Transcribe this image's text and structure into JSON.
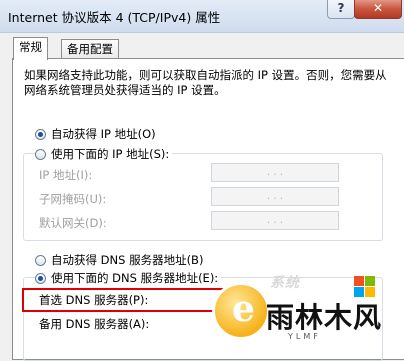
{
  "window": {
    "title": "Internet 协议版本 4 (TCP/IPv4) 属性",
    "help_label": "?",
    "close_label": "✕"
  },
  "tabs": [
    {
      "label": "常规",
      "active": true
    },
    {
      "label": "备用配置",
      "active": false
    }
  ],
  "description": "如果网络支持此功能，则可以获取自动指派的 IP 设置。否则，您需要从网络系统管理员处获得适当的 IP 设置。",
  "ip_section": {
    "auto_label": "自动获得 IP 地址(O)",
    "auto_selected": true,
    "manual_label": "使用下面的 IP 地址(S):",
    "manual_selected": false,
    "fields": [
      {
        "label": "IP 地址(I):",
        "value": ".   .   ."
      },
      {
        "label": "子网掩码(U):",
        "value": ".   .   ."
      },
      {
        "label": "默认网关(D):",
        "value": ".   .   ."
      }
    ]
  },
  "dns_section": {
    "auto_label": "自动获得 DNS 服务器地址(B)",
    "auto_selected": false,
    "manual_label": "使用下面的 DNS 服务器地址(E):",
    "manual_selected": true,
    "preferred_label": "首选 DNS 服务器(P):",
    "alternate_label": "备用 DNS 服务器(A):"
  },
  "watermark": {
    "top_text": "系统",
    "main_text": "雨林木风",
    "sub_text": "YLMF"
  },
  "colors": {
    "highlight_border": "#e00000",
    "close_button": "#c8553f"
  }
}
